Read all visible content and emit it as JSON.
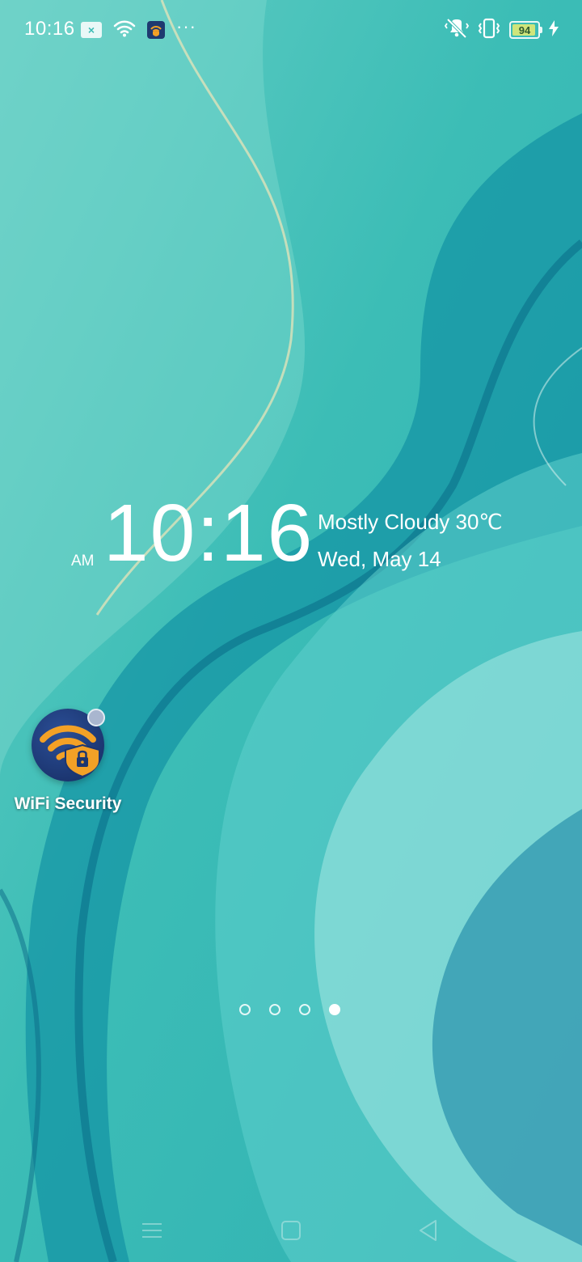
{
  "status_bar": {
    "time": "10:16",
    "battery_level": "94",
    "battery_fraction": 0.94,
    "icons": [
      "notification-x-icon",
      "wifi-icon",
      "wifi-security-app-icon",
      "more-notifications-icon",
      "vibrate-off-icon",
      "vibrate-icon",
      "battery-icon",
      "charging-icon"
    ],
    "more_label": "···"
  },
  "clock_widget": {
    "ampm": "AM",
    "time": "10:16",
    "weather": "Mostly Cloudy 30℃",
    "date": "Wed, May 14"
  },
  "home_apps": [
    {
      "label": "WiFi Security",
      "icon": "wifi-lock-shield-icon",
      "has_badge": true
    }
  ],
  "page_indicator": {
    "total_pages": 4,
    "current_page": 4
  },
  "nav_bar": {
    "buttons": [
      "menu-icon",
      "home-icon",
      "back-icon"
    ]
  },
  "colors": {
    "wallpaper_base": "#3bbcb5",
    "battery_fill": "#cfe57a",
    "app_icon_bg": "#1c3671",
    "app_icon_accent": "#f3a126"
  }
}
